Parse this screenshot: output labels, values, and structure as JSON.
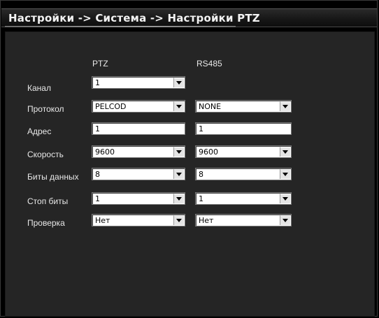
{
  "window": {
    "title": "Настройки -> Система -> Настройки PTZ"
  },
  "columns": {
    "ptz": "PTZ",
    "rs485": "RS485"
  },
  "rows": {
    "channel": {
      "label": "Канал",
      "ptz_value": "1"
    },
    "protocol": {
      "label": "Протокол",
      "ptz_value": "PELCOD",
      "rs485_value": "NONE"
    },
    "address": {
      "label": "Адрес",
      "ptz_value": "1",
      "rs485_value": "1"
    },
    "speed": {
      "label": "Скорость",
      "ptz_value": "9600",
      "rs485_value": "9600"
    },
    "data_bits": {
      "label": "Биты данных",
      "ptz_value": "8",
      "rs485_value": "8"
    },
    "stop_bits": {
      "label": "Стоп биты",
      "ptz_value": "1",
      "rs485_value": "1"
    },
    "parity": {
      "label": "Проверка",
      "ptz_value": "Нет",
      "rs485_value": "Нет"
    }
  },
  "icons": {
    "dropdown_arrow": "chevron-down-icon"
  }
}
